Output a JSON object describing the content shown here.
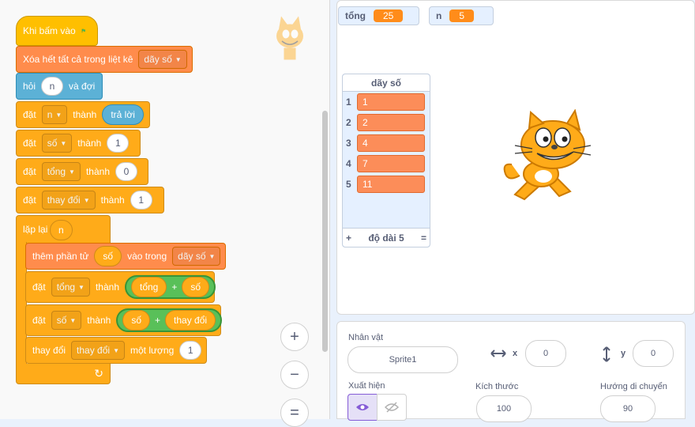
{
  "script": {
    "hat": {
      "label": "Khi bấm vào"
    },
    "clear": {
      "label": "Xóa hết tất cả trong liệt kê",
      "list": "dãy số"
    },
    "ask": {
      "label1": "hỏi",
      "question": "n",
      "label2": "và đợi"
    },
    "set_n": {
      "set": "đặt",
      "var": "n",
      "to": "thành",
      "value": "trả lời"
    },
    "set_so": {
      "set": "đặt",
      "var": "số",
      "to": "thành",
      "value": "1"
    },
    "set_tong": {
      "set": "đặt",
      "var": "tổng",
      "to": "thành",
      "value": "0"
    },
    "set_thaydoi": {
      "set": "đặt",
      "var": "thay đổi",
      "to": "thành",
      "value": "1"
    },
    "repeat": {
      "label": "lặp lại",
      "count": "n"
    },
    "add_item": {
      "label1": "thêm phần tử",
      "item": "số",
      "label2": "vào trong",
      "list": "dãy số"
    },
    "set_tong2": {
      "set": "đặt",
      "var": "tổng",
      "to": "thành",
      "a": "tổng",
      "op": "+",
      "b": "số"
    },
    "set_so2": {
      "set": "đặt",
      "var": "số",
      "to": "thành",
      "a": "số",
      "op": "+",
      "b": "thay đổi"
    },
    "change": {
      "label1": "thay đổi",
      "var": "thay đổi",
      "label2": "một lượng",
      "value": "1"
    },
    "loop_arrow": "↻"
  },
  "zoom": {
    "in": "+",
    "out": "−",
    "reset": "="
  },
  "stage": {
    "monitors": [
      {
        "name": "tổng",
        "value": "25"
      },
      {
        "name": "n",
        "value": "5"
      }
    ],
    "list": {
      "title": "dãy số",
      "items": [
        {
          "index": "1",
          "value": "1"
        },
        {
          "index": "2",
          "value": "2"
        },
        {
          "index": "3",
          "value": "4"
        },
        {
          "index": "4",
          "value": "7"
        },
        {
          "index": "5",
          "value": "11"
        }
      ],
      "add": "+",
      "length_label": "độ dài 5",
      "resize": "="
    }
  },
  "sprite_panel": {
    "sprite_label": "Nhân vật",
    "sprite_name": "Sprite1",
    "x_label": "x",
    "x_value": "0",
    "y_label": "y",
    "y_value": "0",
    "show_label": "Xuất hiện",
    "size_label": "Kích thước",
    "size_value": "100",
    "direction_label": "Hướng di chuyển",
    "direction_value": "90"
  },
  "colors": {
    "events": "#ffbf00",
    "variables": "#ffab19",
    "lists": "#ff8c4c",
    "sensing": "#5cb1d6",
    "operators": "#59c059"
  }
}
